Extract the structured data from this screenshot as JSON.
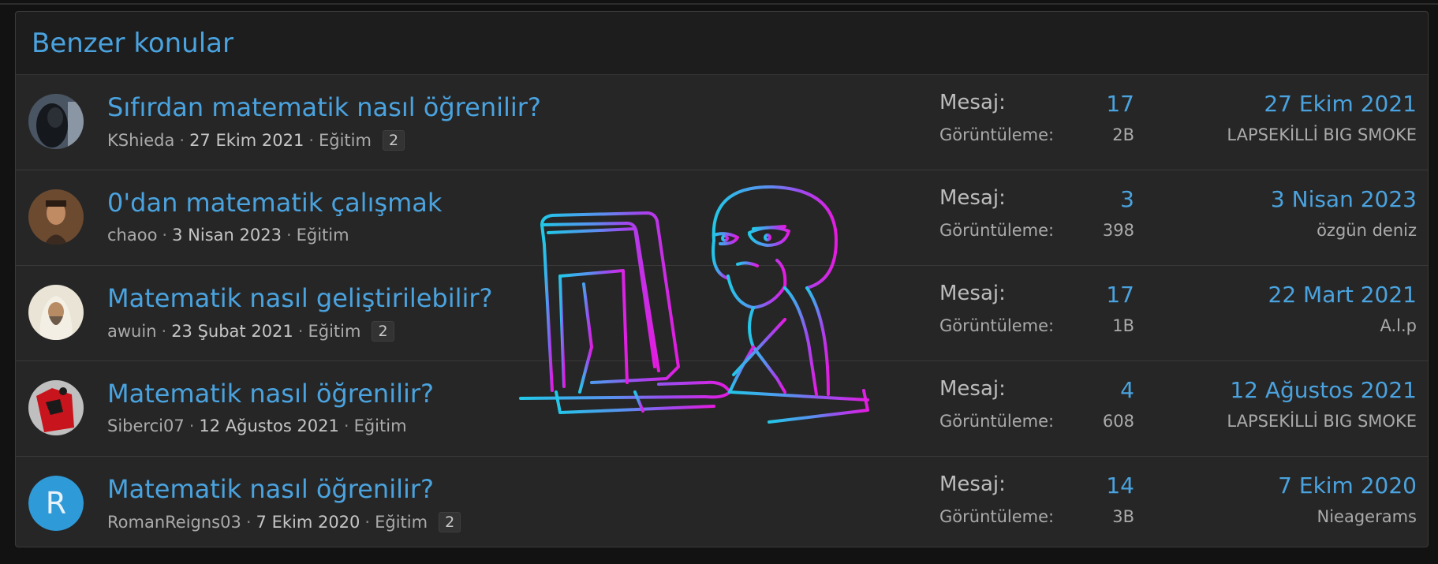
{
  "section_title": "Benzer konular",
  "stat_labels": {
    "messages": "Mesaj:",
    "views": "Görüntüleme:"
  },
  "threads": [
    {
      "title": "Sıfırdan matematik nasıl öğrenilir?",
      "author": "KShieda",
      "date": "27 Ekim 2021",
      "forum": "Eğitim",
      "pages": "2",
      "messages": "17",
      "views": "2B",
      "last_date": "27 Ekim 2021",
      "last_user": "LAPSEKİLLİ BIG SMOKE",
      "avatar": "hooded-figure"
    },
    {
      "title": "0'dan matematik çalışmak",
      "author": "chaoo",
      "date": "3 Nisan 2023",
      "forum": "Eğitim",
      "pages": "",
      "messages": "3",
      "views": "398",
      "last_date": "3 Nisan 2023",
      "last_user": "özgün deniz",
      "avatar": "man-photo"
    },
    {
      "title": "Matematik nasıl geliştirilebilir?",
      "author": "awuin",
      "date": "23 Şubat 2021",
      "forum": "Eğitim",
      "pages": "2",
      "messages": "17",
      "views": "1B",
      "last_date": "22 Mart 2021",
      "last_user": "A.l.p",
      "avatar": "bearded-man"
    },
    {
      "title": "Matematik nasıl öğrenilir?",
      "author": "Siberci07",
      "date": "12 Ağustos 2021",
      "forum": "Eğitim",
      "pages": "",
      "messages": "4",
      "views": "608",
      "last_date": "12 Ağustos 2021",
      "last_user": "LAPSEKİLLİ BIG SMOKE",
      "avatar": "red-dog-logo"
    },
    {
      "title": "Matematik nasıl öğrenilir?",
      "author": "RomanReigns03",
      "date": "7 Ekim 2020",
      "forum": "Eğitim",
      "pages": "2",
      "messages": "14",
      "views": "3B",
      "last_date": "7 Ekim 2020",
      "last_user": "Nieagerams",
      "avatar": "R"
    }
  ],
  "colors": {
    "accent": "#4aa3df",
    "avatar_letter_bg": "#2f9ad8",
    "meme_cyan": "#22c8e8",
    "meme_magenta": "#e51be0"
  }
}
